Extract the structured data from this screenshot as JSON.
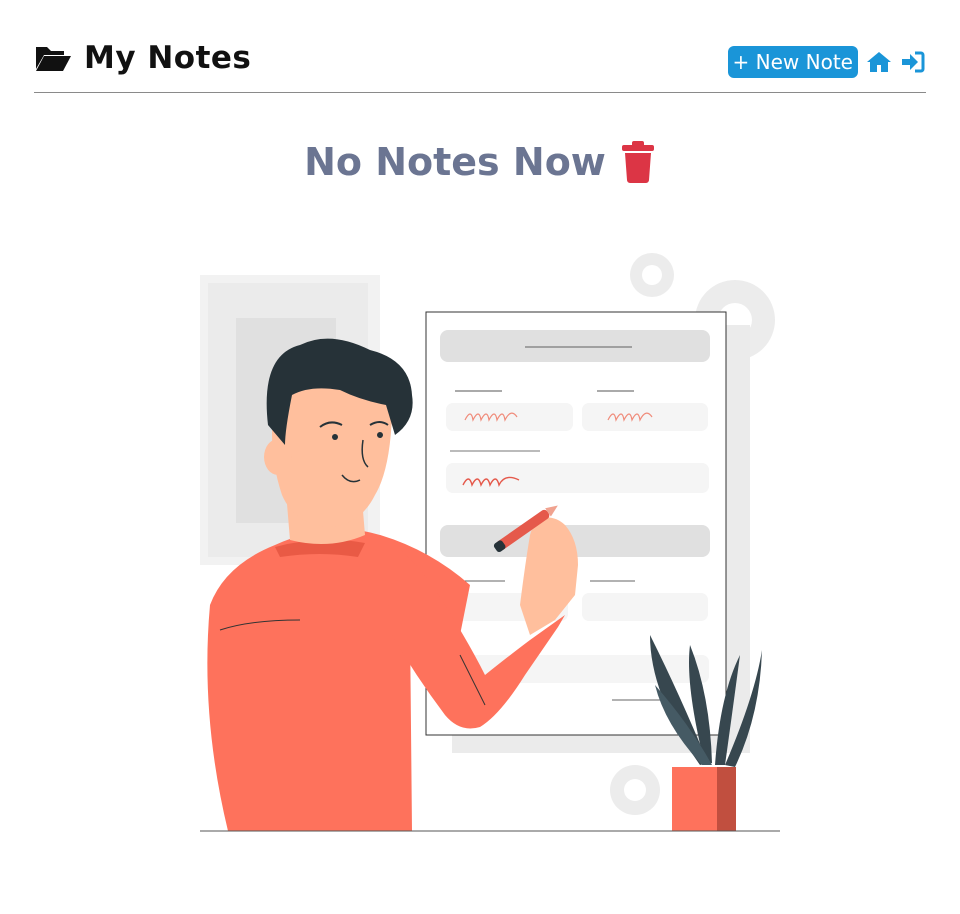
{
  "header": {
    "title": "My Notes",
    "new_note_label": "+ New Note",
    "icons": [
      "folder-open-icon",
      "home-icon",
      "sign-in-icon"
    ]
  },
  "empty_state": {
    "message": "No Notes Now",
    "icon": "trash-icon"
  },
  "colors": {
    "accent": "#1a95d8",
    "muted_text": "#6b7592",
    "danger": "#dc3545",
    "illustration_shirt": "#fe725c"
  }
}
